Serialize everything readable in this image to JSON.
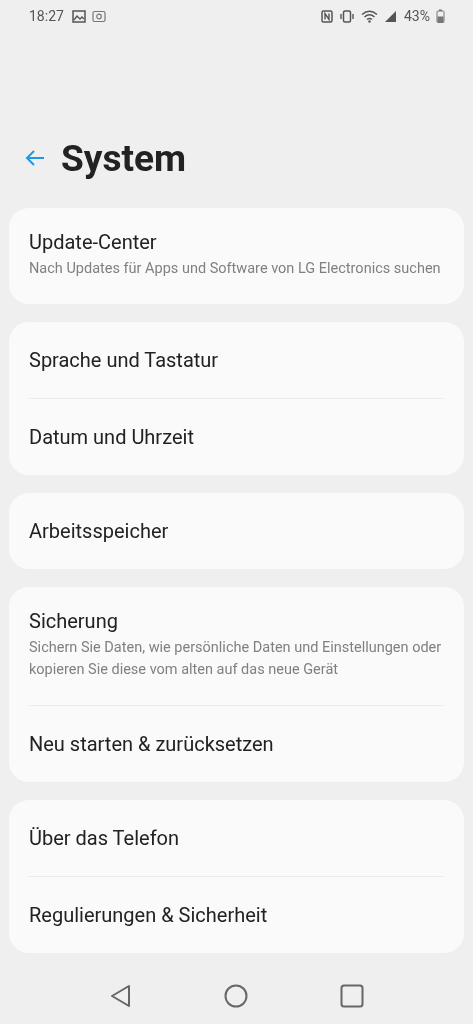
{
  "status_bar": {
    "time": "18:27",
    "battery": "43%"
  },
  "header": {
    "title": "System"
  },
  "groups": [
    {
      "items": [
        {
          "title": "Update-Center",
          "subtitle": "Nach Updates für Apps und Software von LG Electronics suchen"
        }
      ]
    },
    {
      "items": [
        {
          "title": "Sprache und Tastatur"
        },
        {
          "title": "Datum und Uhrzeit"
        }
      ]
    },
    {
      "items": [
        {
          "title": "Arbeitsspeicher"
        }
      ]
    },
    {
      "items": [
        {
          "title": "Sicherung",
          "subtitle": "Sichern Sie Daten, wie persönliche Daten und Einstellungen oder kopieren Sie diese vom alten auf das neue Gerät"
        },
        {
          "title": "Neu starten & zurücksetzen"
        }
      ]
    },
    {
      "items": [
        {
          "title": "Über das Telefon"
        },
        {
          "title": "Regulierungen & Sicherheit"
        }
      ]
    }
  ]
}
